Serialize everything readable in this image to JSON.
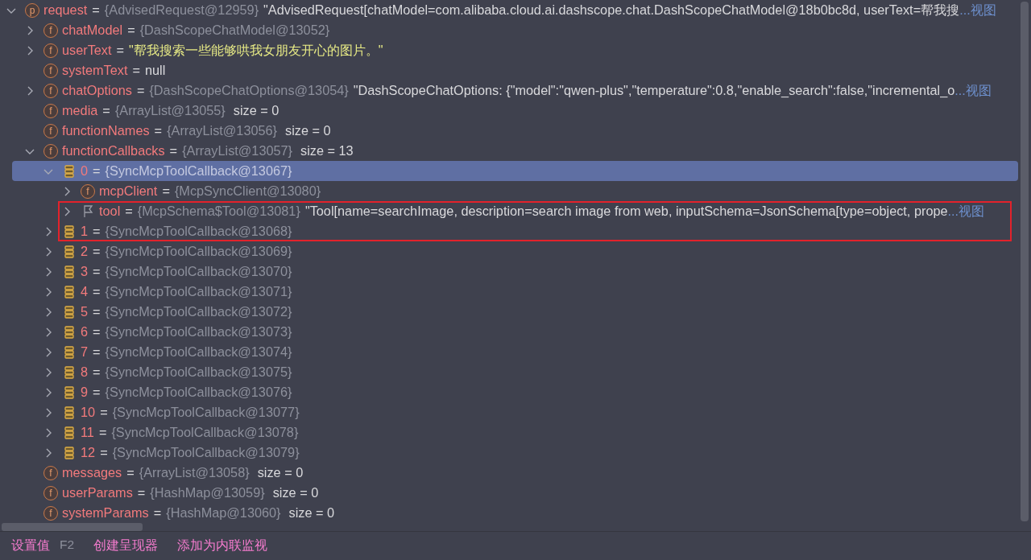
{
  "tree": [
    {
      "kind": "property",
      "badge": "p",
      "name": "request",
      "eq": "=",
      "type": "{AdvisedRequest@12959}",
      "value": "\"AdvisedRequest[chatModel=com.alibaba.cloud.ai.dashscope.chat.DashScopeChatModel@18b0bc8d, userText=帮我搜",
      "is_string": false,
      "link": "...视图",
      "expanded": true,
      "selected": false,
      "children": [
        {
          "kind": "field",
          "badge": "f",
          "name": "chatModel",
          "eq": "=",
          "type": "{DashScopeChatModel@13052}",
          "expanded": false,
          "selected": false
        },
        {
          "kind": "field",
          "badge": "f",
          "name": "userText",
          "eq": "=",
          "value": "\"帮我搜索一些能够哄我女朋友开心的图片。\"",
          "is_string": true,
          "expanded": false,
          "selected": false
        },
        {
          "kind": "field",
          "badge": "f",
          "name": "systemText",
          "eq": "=",
          "value": "null",
          "is_string": false,
          "selected": false
        },
        {
          "kind": "field",
          "badge": "f",
          "name": "chatOptions",
          "eq": "=",
          "type": "{DashScopeChatOptions@13054}",
          "value": "\"DashScopeChatOptions: {\"model\":\"qwen-plus\",\"temperature\":0.8,\"enable_search\":false,\"incremental_o",
          "is_string": false,
          "link": "...视图",
          "expanded": false,
          "selected": false
        },
        {
          "kind": "field",
          "badge": "f",
          "name": "media",
          "eq": "=",
          "type": "{ArrayList@13055}",
          "value": "size = 0",
          "is_string": false,
          "selected": false
        },
        {
          "kind": "field",
          "badge": "f",
          "name": "functionNames",
          "eq": "=",
          "type": "{ArrayList@13056}",
          "value": "size = 0",
          "is_string": false,
          "selected": false
        },
        {
          "kind": "field",
          "badge": "f",
          "name": "functionCallbacks",
          "eq": "=",
          "type": "{ArrayList@13057}",
          "value": "size = 13",
          "is_string": false,
          "expanded": true,
          "selected": false,
          "children": [
            {
              "kind": "element",
              "name": "0",
              "eq": "=",
              "type": "{SyncMcpToolCallback@13067}",
              "expanded": true,
              "selected": true,
              "children": [
                {
                  "kind": "field",
                  "badge": "f",
                  "name": "mcpClient",
                  "eq": "=",
                  "type": "{McpSyncClient@13080}",
                  "expanded": false,
                  "selected": false
                },
                {
                  "kind": "flagged",
                  "name": "tool",
                  "eq": "=",
                  "type": "{McpSchema$Tool@13081}",
                  "value": "\"Tool[name=searchImage, description=search image from web, inputSchema=JsonSchema[type=object, prope",
                  "is_string": false,
                  "link": "...视图",
                  "expanded": false,
                  "selected": false,
                  "boxed": true
                }
              ]
            },
            {
              "kind": "element",
              "name": "1",
              "eq": "=",
              "type": "{SyncMcpToolCallback@13068}",
              "expanded": false,
              "selected": false,
              "boxed": true
            },
            {
              "kind": "element",
              "name": "2",
              "eq": "=",
              "type": "{SyncMcpToolCallback@13069}",
              "expanded": false,
              "selected": false
            },
            {
              "kind": "element",
              "name": "3",
              "eq": "=",
              "type": "{SyncMcpToolCallback@13070}",
              "expanded": false,
              "selected": false
            },
            {
              "kind": "element",
              "name": "4",
              "eq": "=",
              "type": "{SyncMcpToolCallback@13071}",
              "expanded": false,
              "selected": false
            },
            {
              "kind": "element",
              "name": "5",
              "eq": "=",
              "type": "{SyncMcpToolCallback@13072}",
              "expanded": false,
              "selected": false
            },
            {
              "kind": "element",
              "name": "6",
              "eq": "=",
              "type": "{SyncMcpToolCallback@13073}",
              "expanded": false,
              "selected": false
            },
            {
              "kind": "element",
              "name": "7",
              "eq": "=",
              "type": "{SyncMcpToolCallback@13074}",
              "expanded": false,
              "selected": false
            },
            {
              "kind": "element",
              "name": "8",
              "eq": "=",
              "type": "{SyncMcpToolCallback@13075}",
              "expanded": false,
              "selected": false
            },
            {
              "kind": "element",
              "name": "9",
              "eq": "=",
              "type": "{SyncMcpToolCallback@13076}",
              "expanded": false,
              "selected": false
            },
            {
              "kind": "element",
              "name": "10",
              "eq": "=",
              "type": "{SyncMcpToolCallback@13077}",
              "expanded": false,
              "selected": false
            },
            {
              "kind": "element",
              "name": "11",
              "eq": "=",
              "type": "{SyncMcpToolCallback@13078}",
              "expanded": false,
              "selected": false
            },
            {
              "kind": "element",
              "name": "12",
              "eq": "=",
              "type": "{SyncMcpToolCallback@13079}",
              "expanded": false,
              "selected": false
            }
          ]
        },
        {
          "kind": "field",
          "badge": "f",
          "name": "messages",
          "eq": "=",
          "type": "{ArrayList@13058}",
          "value": "size = 0",
          "is_string": false,
          "selected": false
        },
        {
          "kind": "field",
          "badge": "f",
          "name": "userParams",
          "eq": "=",
          "type": "{HashMap@13059}",
          "value": "size = 0",
          "is_string": false,
          "selected": false
        },
        {
          "kind": "field",
          "badge": "f",
          "name": "systemParams",
          "eq": "=",
          "type": "{HashMap@13060}",
          "value": "size = 0",
          "is_string": false,
          "selected": false
        }
      ]
    }
  ],
  "footer": [
    {
      "label": "设置值",
      "shortcut": "F2"
    },
    {
      "label": "创建呈现器"
    },
    {
      "label": "添加为内联监视"
    }
  ]
}
